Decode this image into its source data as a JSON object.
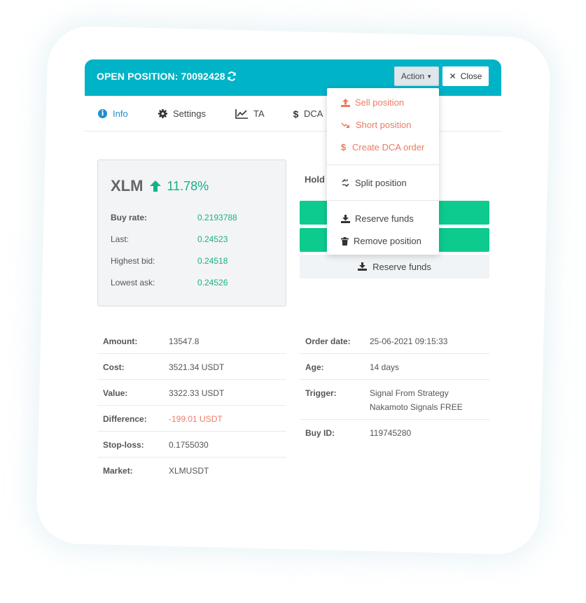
{
  "header": {
    "title": "OPEN POSITION: 70092428",
    "action_label": "Action",
    "close_label": "Close"
  },
  "tabs": [
    {
      "label": "Info",
      "icon": "info-icon",
      "active": true
    },
    {
      "label": "Settings",
      "icon": "gear-icon"
    },
    {
      "label": "TA",
      "icon": "line-chart-icon"
    },
    {
      "label": "DCA",
      "icon": "dollar-icon"
    }
  ],
  "coin": {
    "symbol": "XLM",
    "change": "11.78%",
    "rates": [
      {
        "label": "Buy rate:",
        "value": "0.2193788"
      },
      {
        "label": "Last:",
        "value": "0.24523"
      },
      {
        "label": "Highest bid:",
        "value": "0.24518"
      },
      {
        "label": "Lowest ask:",
        "value": "0.24526"
      }
    ]
  },
  "hold_label": "Hold",
  "reserve_funds_label": "Reserve funds",
  "dropdown": {
    "items": [
      {
        "label": "Sell position",
        "icon": "upload-icon"
      },
      {
        "label": "Short position",
        "icon": "trend-down-icon"
      },
      {
        "label": "Create DCA order",
        "icon": "dollar-icon"
      },
      {
        "label": "Split position",
        "icon": "split-icon"
      },
      {
        "label": "Reserve funds",
        "icon": "download-icon"
      },
      {
        "label": "Remove position",
        "icon": "trash-icon"
      }
    ]
  },
  "details_left": [
    {
      "label": "Amount:",
      "value": "13547.8"
    },
    {
      "label": "Cost:",
      "value": "3521.34 USDT"
    },
    {
      "label": "Value:",
      "value": "3322.33 USDT"
    },
    {
      "label": "Difference:",
      "value": "-199.01 USDT"
    },
    {
      "label": "Stop-loss:",
      "value": "0.1755030"
    },
    {
      "label": "Market:",
      "value": "XLMUSDT"
    }
  ],
  "details_right": [
    {
      "label": "Order date:",
      "value": "25-06-2021 09:15:33"
    },
    {
      "label": "Age:",
      "value": "14 days"
    },
    {
      "label": "Trigger:",
      "value": "Signal From Strategy",
      "value2": "Nakamoto Signals FREE"
    },
    {
      "label": "Buy ID:",
      "value": "119745280"
    }
  ],
  "colors": {
    "header": "#00b3c7",
    "positive": "#16b08a",
    "negative": "#f07a66",
    "green_button": "#0dcb8f",
    "active_tab": "#1f8fcc"
  }
}
